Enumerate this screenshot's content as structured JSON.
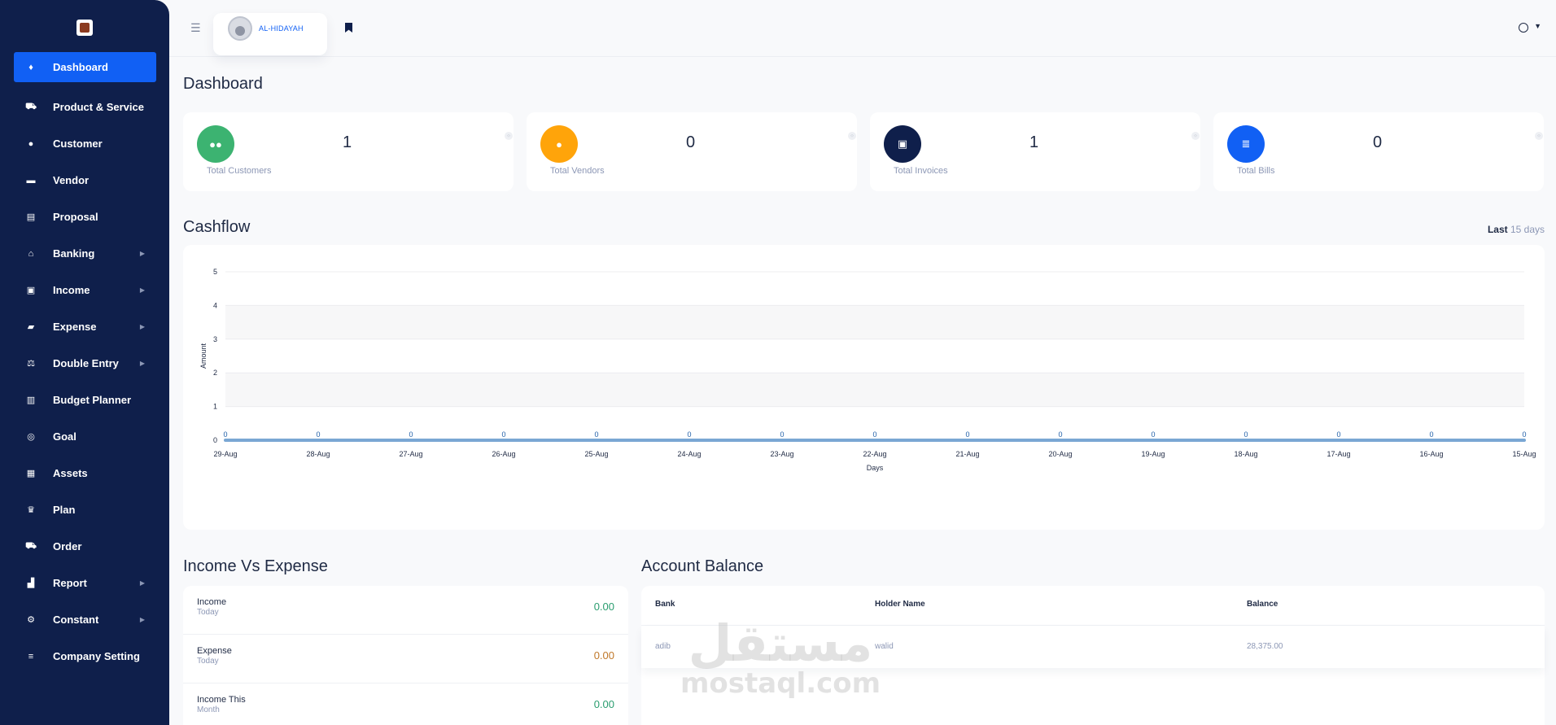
{
  "sidebar": {
    "items": [
      {
        "label": "Dashboard",
        "icon": "fire-icon",
        "active": true,
        "has_submenu": false
      },
      {
        "label": "Product & Service",
        "icon": "cart-icon",
        "active": false,
        "has_submenu": false
      },
      {
        "label": "Customer",
        "icon": "user-icon",
        "active": false,
        "has_submenu": false
      },
      {
        "label": "Vendor",
        "icon": "note-icon",
        "active": false,
        "has_submenu": false
      },
      {
        "label": "Proposal",
        "icon": "document-icon",
        "active": false,
        "has_submenu": false
      },
      {
        "label": "Banking",
        "icon": "bank-icon",
        "active": false,
        "has_submenu": true
      },
      {
        "label": "Income",
        "icon": "money-icon",
        "active": false,
        "has_submenu": true
      },
      {
        "label": "Expense",
        "icon": "money-hand-icon",
        "active": false,
        "has_submenu": true
      },
      {
        "label": "Double Entry",
        "icon": "balance-scale-icon",
        "active": false,
        "has_submenu": true
      },
      {
        "label": "Budget Planner",
        "icon": "clipboard-icon",
        "active": false,
        "has_submenu": false
      },
      {
        "label": "Goal",
        "icon": "target-icon",
        "active": false,
        "has_submenu": false
      },
      {
        "label": "Assets",
        "icon": "calculator-icon",
        "active": false,
        "has_submenu": false
      },
      {
        "label": "Plan",
        "icon": "trophy-icon",
        "active": false,
        "has_submenu": false
      },
      {
        "label": "Order",
        "icon": "cart-plus-icon",
        "active": false,
        "has_submenu": false
      },
      {
        "label": "Report",
        "icon": "bar-chart-icon",
        "active": false,
        "has_submenu": true
      },
      {
        "label": "Constant",
        "icon": "gear-icon",
        "active": false,
        "has_submenu": true
      },
      {
        "label": "Company Setting",
        "icon": "sliders-icon",
        "active": false,
        "has_submenu": false
      }
    ]
  },
  "header": {
    "user_name": "AL-HIDAYAH"
  },
  "page": {
    "title": "Dashboard"
  },
  "stats": [
    {
      "value": "1",
      "label": "Total Customers",
      "color": "#3cb371",
      "icon": "users-icon"
    },
    {
      "value": "0",
      "label": "Total Vendors",
      "color": "#ffa40a",
      "icon": "user-icon"
    },
    {
      "value": "1",
      "label": "Total Invoices",
      "color": "#0f1f4b",
      "icon": "money-icon"
    },
    {
      "value": "0",
      "label": "Total Bills",
      "color": "#1160f4",
      "icon": "database-icon"
    }
  ],
  "cashflow": {
    "title": "Cashflow",
    "range_prefix": "Last",
    "range_value": "15 days"
  },
  "chart_data": {
    "type": "line",
    "xlabel": "Days",
    "ylabel": "Amount",
    "ylim": [
      0,
      5
    ],
    "yticks": [
      0,
      1,
      2,
      3,
      4,
      5
    ],
    "categories": [
      "29-Aug",
      "28-Aug",
      "27-Aug",
      "26-Aug",
      "25-Aug",
      "24-Aug",
      "23-Aug",
      "22-Aug",
      "21-Aug",
      "20-Aug",
      "19-Aug",
      "18-Aug",
      "17-Aug",
      "16-Aug",
      "15-Aug"
    ],
    "series": [
      {
        "values": [
          0,
          0,
          0,
          0,
          0,
          0,
          0,
          0,
          0,
          0,
          0,
          0,
          0,
          0,
          0
        ],
        "color": "#7aa7d4"
      }
    ],
    "grid": true,
    "data_labels": true
  },
  "income_expense": {
    "title": "Income Vs Expense",
    "rows": [
      {
        "label": "Income",
        "sub": "Today",
        "value": "0.00",
        "color": "#2a9d6f"
      },
      {
        "label": "Expense",
        "sub": "Today",
        "value": "0.00",
        "color": "#c0782a"
      },
      {
        "label": "Income This",
        "sub": "Month",
        "value": "0.00",
        "color": "#2a9d6f"
      }
    ]
  },
  "account_balance": {
    "title": "Account Balance",
    "columns": [
      "Bank",
      "Holder Name",
      "Balance"
    ],
    "rows": [
      [
        "adib",
        "walid",
        "28,375.00"
      ]
    ]
  },
  "watermark": {
    "arabic": "مستقل",
    "latin": "mostaql.com"
  }
}
